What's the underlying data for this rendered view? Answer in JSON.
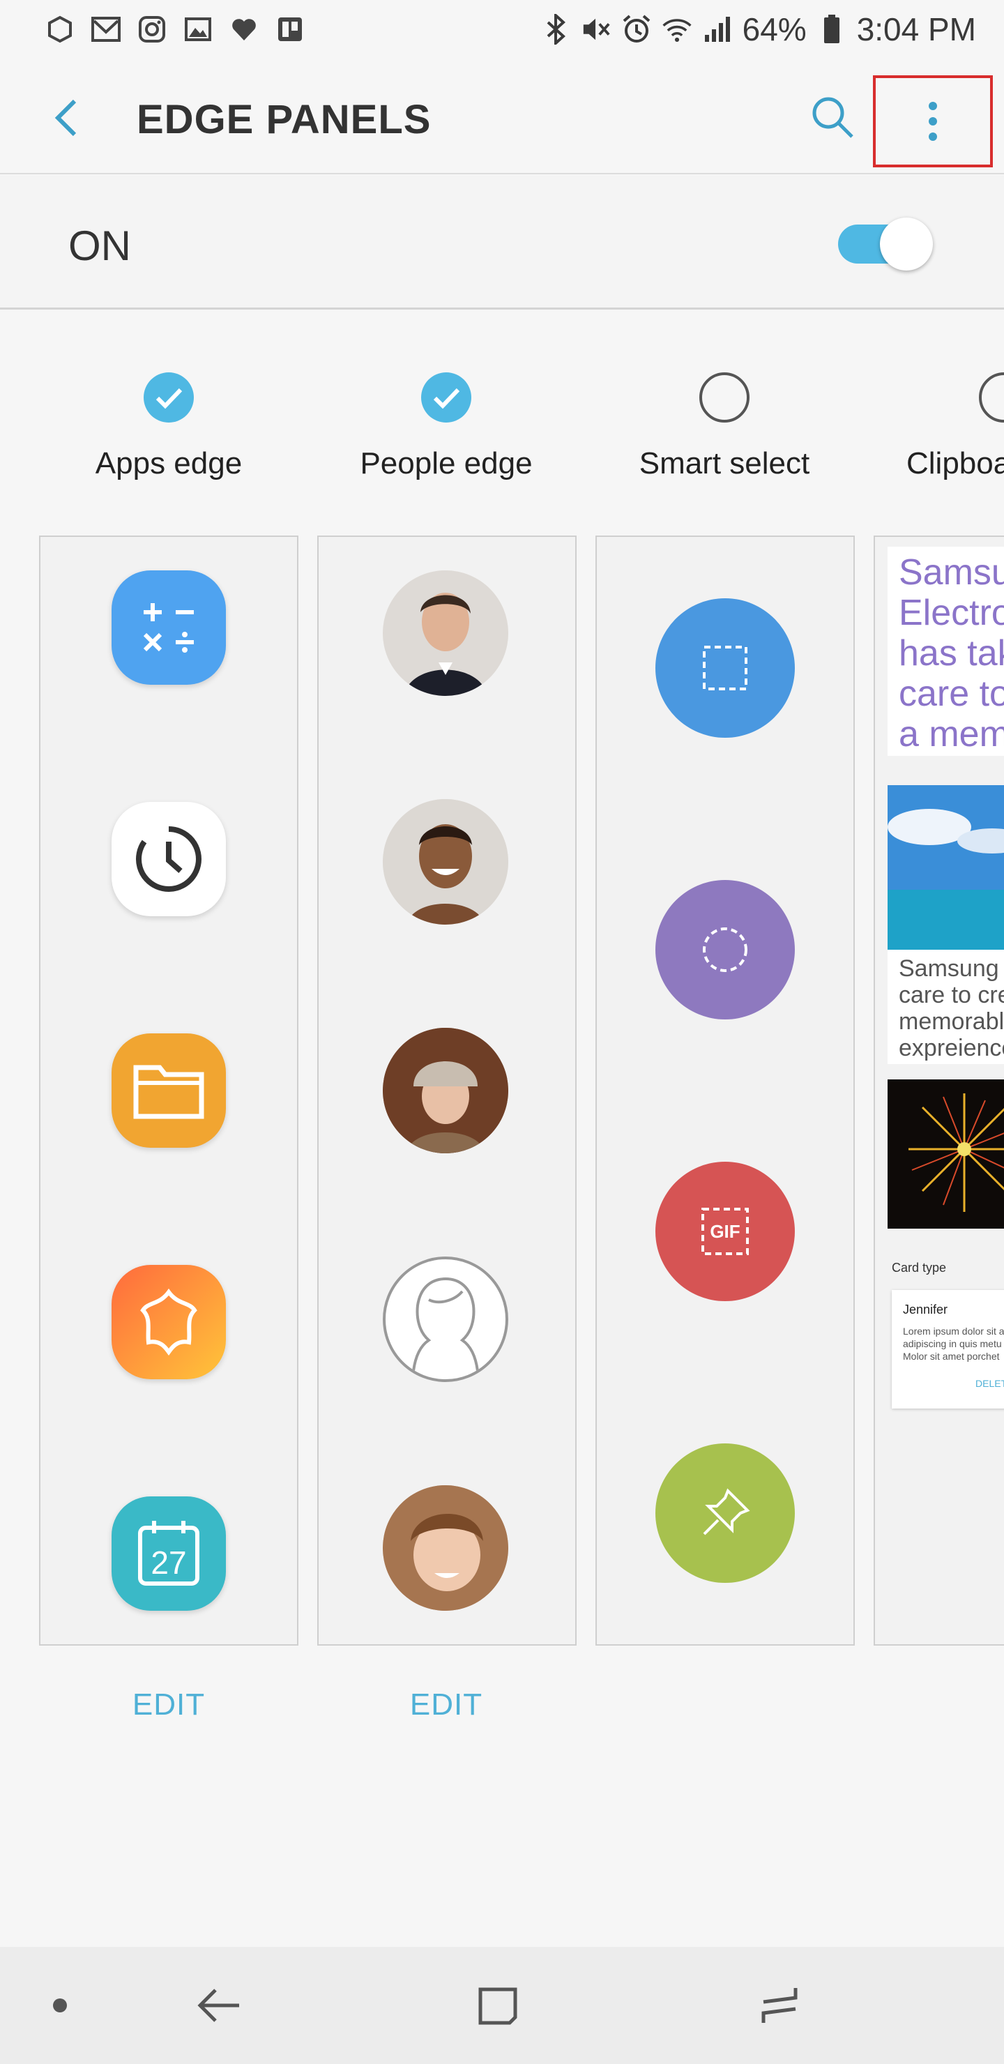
{
  "status_bar": {
    "battery": "64%",
    "time": "3:04 PM"
  },
  "app_bar": {
    "title": "EDGE PANELS"
  },
  "master_switch": {
    "label": "ON",
    "enabled": true
  },
  "panels": [
    {
      "name": "Apps edge",
      "checked": true,
      "edit_label": "EDIT"
    },
    {
      "name": "People edge",
      "checked": true,
      "edit_label": "EDIT"
    },
    {
      "name": "Smart select",
      "checked": false
    },
    {
      "name": "Clipboa",
      "checked": false
    }
  ],
  "apps_edge_icons": [
    "calculator-icon",
    "clock-icon",
    "my-files-icon",
    "bixby-icon",
    "calendar-icon"
  ],
  "calendar_day": "27",
  "smart_select_tools": [
    {
      "icon": "rectangle-select-icon",
      "color": "#4a98e0"
    },
    {
      "icon": "oval-select-icon",
      "color": "#8e79bf"
    },
    {
      "icon": "animation-gif-icon",
      "color": "#d65454",
      "label": "GIF"
    },
    {
      "icon": "pin-icon",
      "color": "#a7c14e"
    }
  ],
  "clipboard_preview": {
    "text_lines": [
      "Samsu",
      "Electro",
      "has tak",
      "care to",
      "a mem"
    ],
    "caption_lines": [
      "Samsung",
      "care to cre",
      "memorable",
      "expreience"
    ],
    "card_type_label": "Card type",
    "card_name": "Jennifer",
    "card_body_lines": [
      "Lorem ipsum dolor sit a",
      "adipiscing in quis metu",
      "Molor sit amet porchet"
    ],
    "card_action": "DELETE"
  },
  "colors": {
    "accent": "#4fb8e3",
    "highlight_box": "#d82d2d"
  }
}
